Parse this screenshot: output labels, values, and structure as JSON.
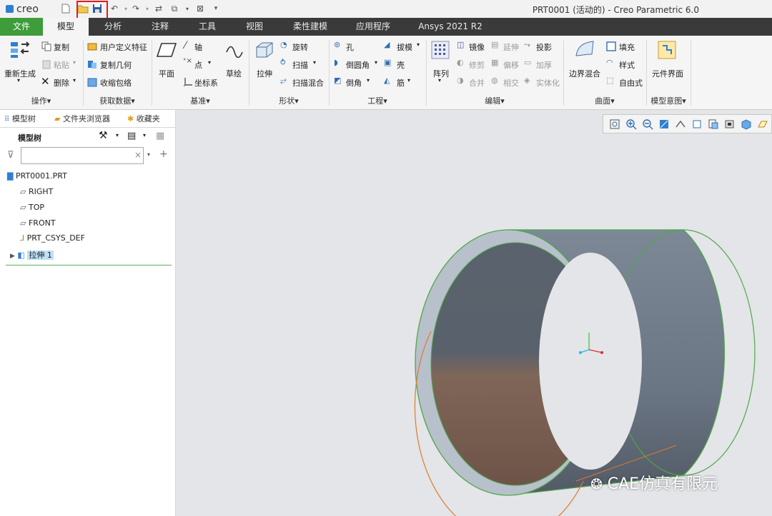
{
  "app": {
    "logo_text": "creo",
    "window_title": "PRT0001 (活动的) - Creo Parametric 6.0"
  },
  "menu_tabs": [
    "文件",
    "模型",
    "分析",
    "注释",
    "工具",
    "视图",
    "柔性建模",
    "应用程序",
    "Ansys 2021 R2"
  ],
  "ribbon": {
    "operations": {
      "label": "操作▾",
      "regen": "重新生成",
      "copy": "复制",
      "paste": "粘贴",
      "delete": "删除"
    },
    "get_data": {
      "label": "获取数据▾",
      "udf": "用户定义特征",
      "copy_geom": "复制几何",
      "shrinkwrap": "收缩包络"
    },
    "datum": {
      "label": "基准▾",
      "plane": "平面",
      "axis": "轴",
      "point": "点",
      "csys": "坐标系",
      "sketch": "草绘"
    },
    "shapes": {
      "label": "形状▾",
      "extrude": "拉伸",
      "revolve": "旋转",
      "sweep": "扫描",
      "swept_blend": "扫描混合"
    },
    "engineering": {
      "label": "工程▾",
      "hole": "孔",
      "round": "倒圆角",
      "chamfer": "倒角",
      "draft": "拔模",
      "shell": "壳",
      "rib": "筋"
    },
    "editing": {
      "label": "编辑▾",
      "pattern": "阵列",
      "mirror": "镜像",
      "extend": "延伸",
      "project": "投影",
      "trim": "修剪",
      "offset": "偏移",
      "thicken": "加厚",
      "merge": "合并",
      "intersect": "相交",
      "solidify": "实体化"
    },
    "surfaces": {
      "label": "曲面▾",
      "boundary_blend": "边界混合",
      "fill": "填充",
      "style": "样式",
      "freestyle": "自由式"
    },
    "intent": {
      "label": "模型意图▾",
      "component_interface": "元件界面"
    }
  },
  "panel": {
    "tabs": [
      "模型树",
      "文件夹浏览器",
      "收藏夹"
    ],
    "header": "模型树",
    "filter_placeholder": "",
    "tree": [
      "PRT0001.PRT",
      "RIGHT",
      "TOP",
      "FRONT",
      "PRT_CSYS_DEF",
      "拉伸 1"
    ]
  },
  "watermark": "CAE仿真有限元",
  "colors": {
    "file_tab": "#3e9c3b",
    "menu_bg": "#3a3a3a",
    "highlight": "#e21b1b",
    "selection": "#bfe0f7"
  }
}
